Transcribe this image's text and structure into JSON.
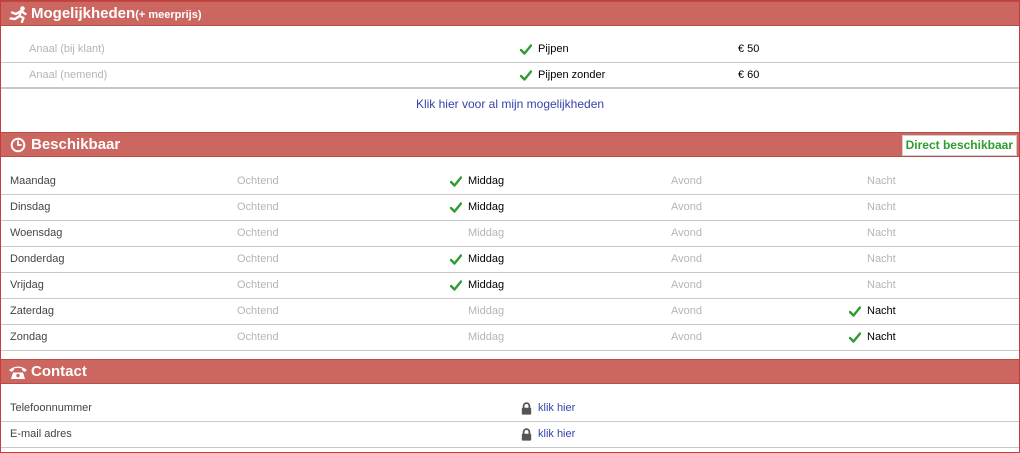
{
  "options": {
    "title": "Mogelijkheden",
    "subtitle": "(+ meerprijs)",
    "items": [
      {
        "name": "Anaal (bij klant)",
        "option": "Pijpen",
        "price": "€ 50"
      },
      {
        "name": "Anaal (nemend)",
        "option": "Pijpen zonder",
        "price": "€ 60"
      }
    ],
    "more_link": "Klik hier voor al mijn mogelijkheden"
  },
  "availability": {
    "title": "Beschikbaar",
    "badge": "Direct beschikbaar",
    "slot_labels": [
      "Ochtend",
      "Middag",
      "Avond",
      "Nacht"
    ],
    "days": [
      {
        "day": "Maandag",
        "slots": [
          false,
          true,
          false,
          false
        ]
      },
      {
        "day": "Dinsdag",
        "slots": [
          false,
          true,
          false,
          false
        ]
      },
      {
        "day": "Woensdag",
        "slots": [
          false,
          false,
          false,
          false
        ]
      },
      {
        "day": "Donderdag",
        "slots": [
          false,
          true,
          false,
          false
        ]
      },
      {
        "day": "Vrijdag",
        "slots": [
          false,
          true,
          false,
          false
        ]
      },
      {
        "day": "Zaterdag",
        "slots": [
          false,
          false,
          false,
          true
        ]
      },
      {
        "day": "Zondag",
        "slots": [
          false,
          false,
          false,
          true
        ]
      }
    ]
  },
  "contact": {
    "title": "Contact",
    "rows": [
      {
        "label": "Telefoonnummer",
        "link": "klik hier"
      },
      {
        "label": "E-mail adres",
        "link": "klik hier"
      }
    ]
  },
  "colors": {
    "header_bg": "#cc6660",
    "frame_border": "#cc3b3b",
    "check_green": "#2e9c2e",
    "link_blue": "#3344aa",
    "muted_text": "#b5b5b5"
  },
  "icons": {
    "options": "runner-icon",
    "availability": "clock-icon",
    "contact": "telephone-icon",
    "check": "checkmark-icon",
    "lock": "lock-icon"
  }
}
